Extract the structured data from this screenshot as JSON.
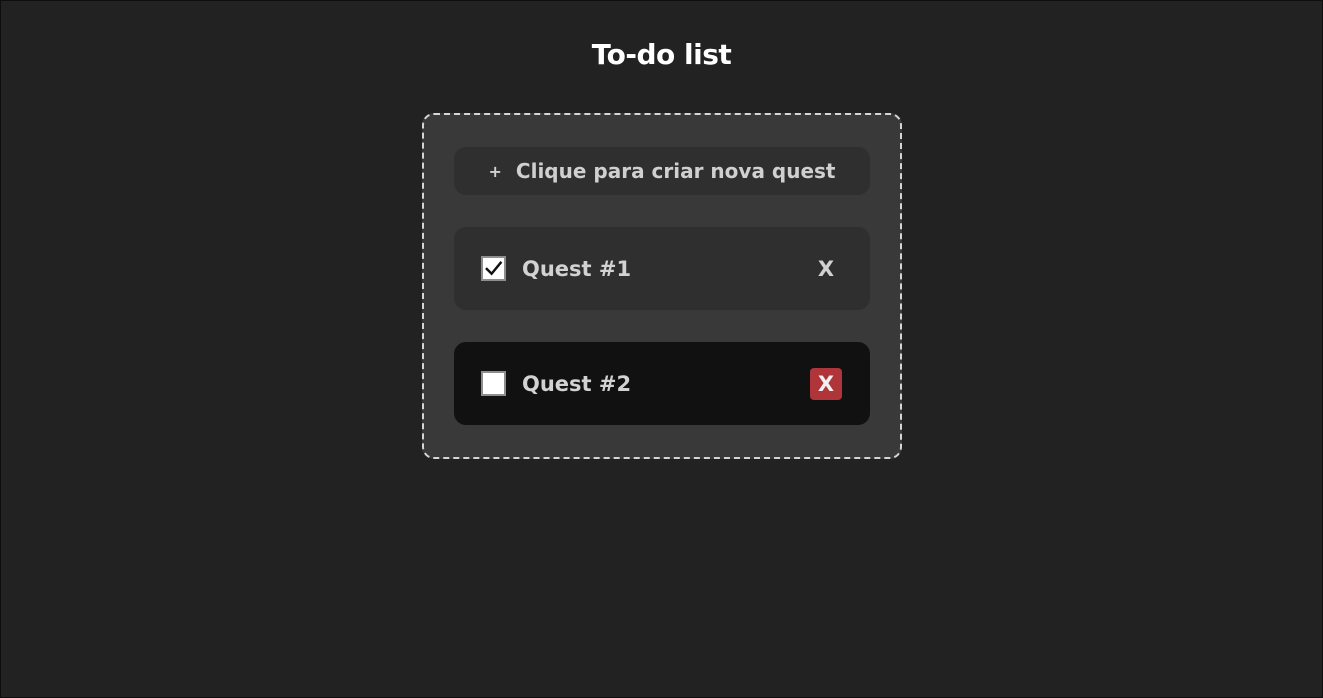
{
  "page": {
    "title": "To-do list"
  },
  "new_quest": {
    "icon": "plus-icon",
    "icon_glyph": "+",
    "label": "Clique para criar nova quest"
  },
  "quests": [
    {
      "label": "Quest #1",
      "checked": true,
      "delete_label": "X"
    },
    {
      "label": "Quest #2",
      "checked": false,
      "delete_label": "X"
    }
  ],
  "colors": {
    "background": "#222222",
    "panel": "#393939",
    "panel_border": "#d6d6d6",
    "item": "#2f2f2f",
    "item_active": "#111111",
    "delete_hover": "#b0353a"
  }
}
